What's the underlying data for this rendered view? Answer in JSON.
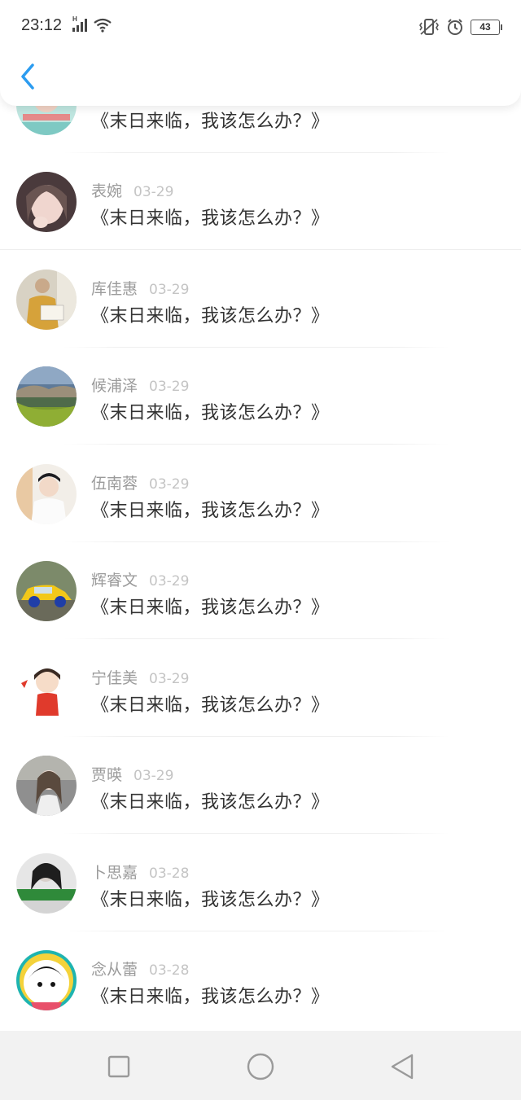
{
  "status_bar": {
    "time": "23:12",
    "signal_label": "H",
    "battery": "43",
    "icons": [
      "signal-icon",
      "wifi-icon",
      "vibrate-icon",
      "alarm-icon",
      "battery-icon"
    ]
  },
  "header": {
    "back_icon": "chevron-left-icon",
    "accent_color": "#2c9cf0"
  },
  "comments": [
    {
      "name": "",
      "date": "",
      "message": "《末日来临，我该怎么办？》"
    },
    {
      "name": "表婉",
      "date": "03-29",
      "message": "《末日来临，我该怎么办？》"
    },
    {
      "name": "库佳惠",
      "date": "03-29",
      "message": "《末日来临，我该怎么办？》"
    },
    {
      "name": "候浦泽",
      "date": "03-29",
      "message": "《末日来临，我该怎么办？》"
    },
    {
      "name": "伍南蓉",
      "date": "03-29",
      "message": "《末日来临，我该怎么办？》"
    },
    {
      "name": "辉睿文",
      "date": "03-29",
      "message": "《末日来临，我该怎么办？》"
    },
    {
      "name": "宁佳美",
      "date": "03-29",
      "message": "《末日来临，我该怎么办？》"
    },
    {
      "name": "贾暎",
      "date": "03-29",
      "message": "《末日来临，我该怎么办？》"
    },
    {
      "name": "卜思嘉",
      "date": "03-28",
      "message": "《末日来临，我该怎么办？》"
    },
    {
      "name": "念从蕾",
      "date": "03-28",
      "message": "《末日来临，我该怎么办？》"
    }
  ],
  "nav_bar": {
    "icons": [
      "recent-apps-icon",
      "home-icon",
      "back-icon"
    ]
  }
}
